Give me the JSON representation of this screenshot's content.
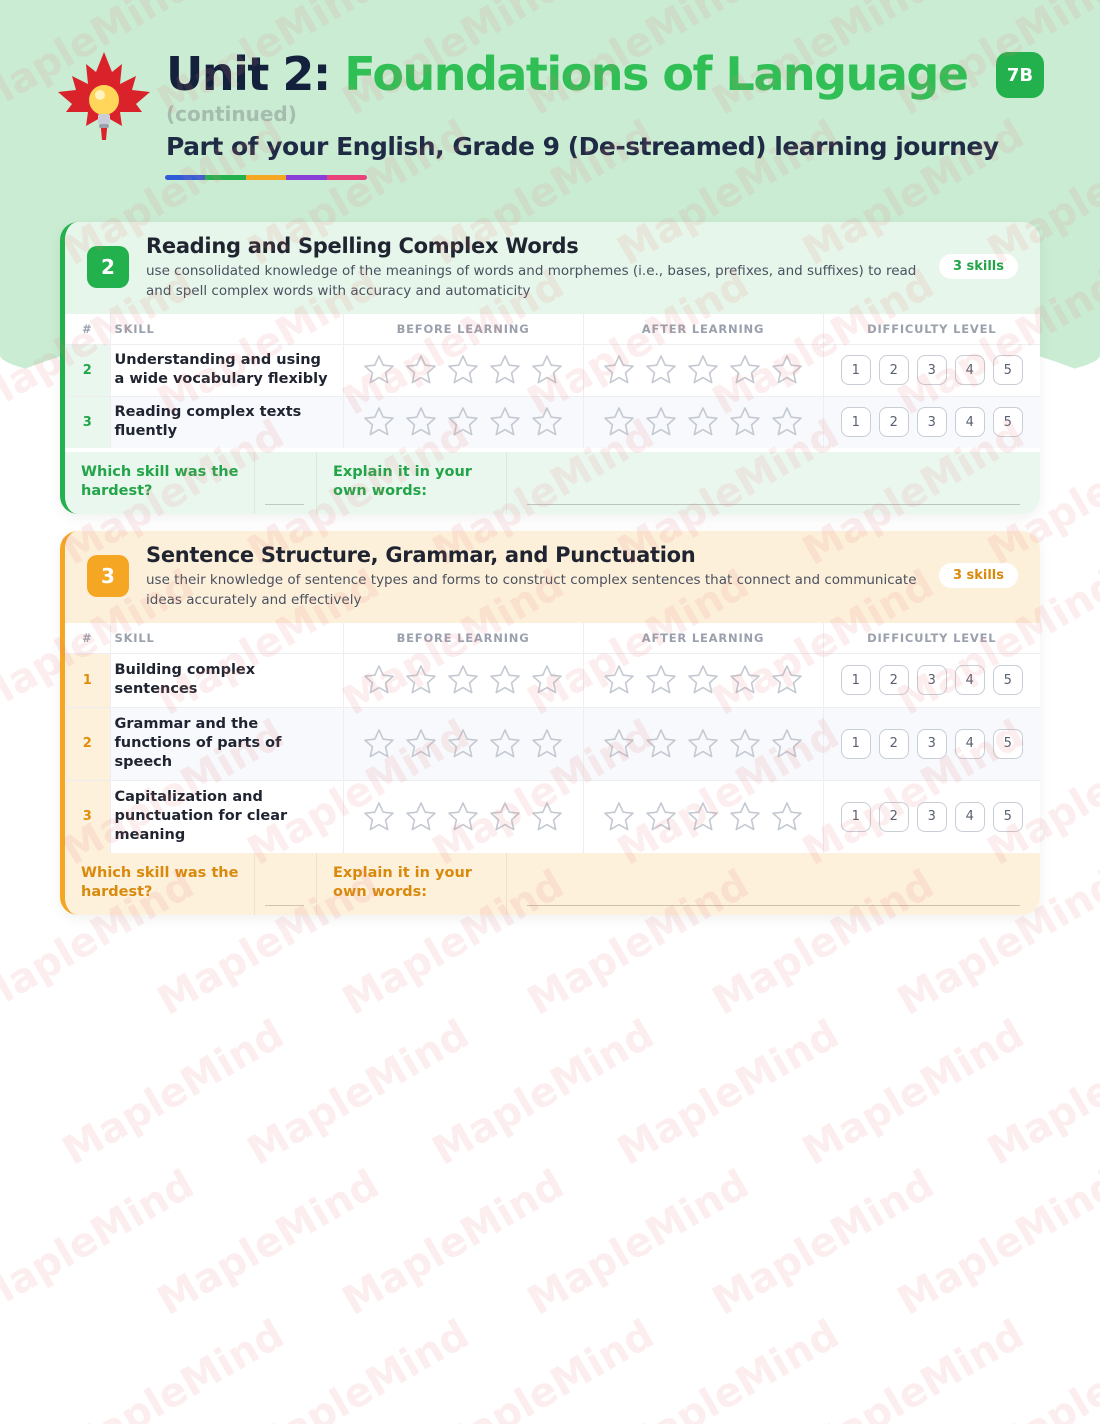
{
  "header": {
    "title_prefix": "Unit 2:",
    "title_main": "Foundations of Language",
    "continued": "(continued)",
    "subtitle": "Part of your English, Grade 9 (De-streamed) learning journey",
    "badge": "7B",
    "bar_colors": [
      "#2f5bd8",
      "#22b14c",
      "#f5a623",
      "#8b3fd9",
      "#e8437a"
    ]
  },
  "watermark_text": "MapleMind",
  "table_headers": {
    "index": "#",
    "skill": "SKILL",
    "before": "BEFORE LEARNING",
    "after": "AFTER LEARNING",
    "difficulty": "DIFFICULTY LEVEL"
  },
  "difficulty_levels": [
    "1",
    "2",
    "3",
    "4",
    "5"
  ],
  "footer": {
    "q1": "Which skill was the hardest?",
    "q2": "Explain it in your own words:"
  },
  "sections": [
    {
      "number": "2",
      "title": "Reading and Spelling Complex Words",
      "description": "use consolidated knowledge of the meanings of words and morphemes (i.e., bases, prefixes, and suffixes) to read and spell complex words with accuracy and automaticity",
      "skills_count": "3 skills",
      "color": "#22b14c",
      "rows": [
        {
          "index": "2",
          "skill": "Understanding and using a wide vocabulary flexibly"
        },
        {
          "index": "3",
          "skill": "Reading complex texts fluently"
        }
      ]
    },
    {
      "number": "3",
      "title": "Sentence Structure, Grammar, and Punctuation",
      "description": "use their knowledge of sentence types and forms to construct complex sentences that connect and communicate ideas accurately and effectively",
      "skills_count": "3 skills",
      "color": "#f5a623",
      "rows": [
        {
          "index": "1",
          "skill": "Building complex sentences"
        },
        {
          "index": "2",
          "skill": "Grammar and the functions of parts of speech"
        },
        {
          "index": "3",
          "skill": "Capitalization and punctuation for clear meaning"
        }
      ]
    }
  ]
}
